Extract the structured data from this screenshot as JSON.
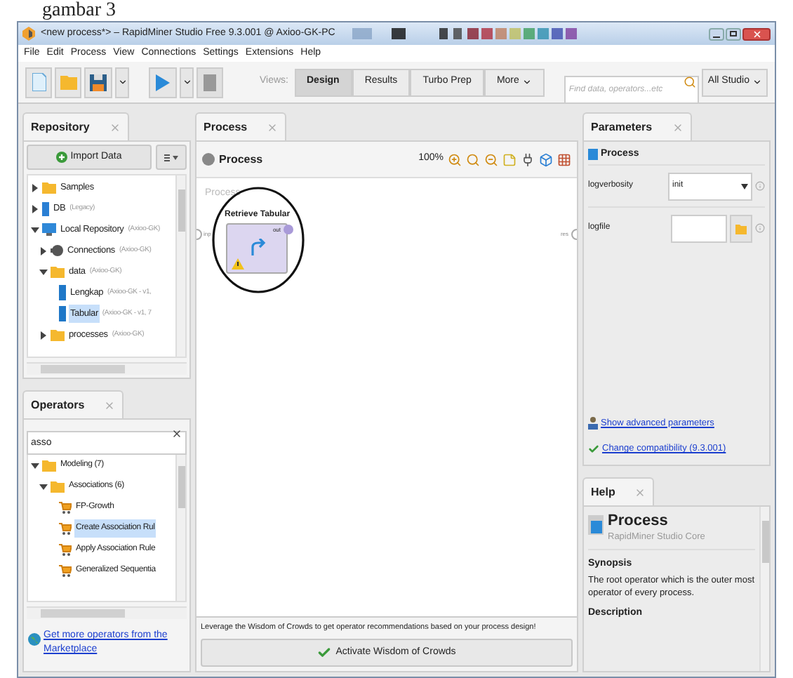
{
  "caption": "gambar 3",
  "window": {
    "title": "<new process*> – RapidMiner Studio Free 9.3.001 @ Axioo-GK-PC"
  },
  "menu": [
    "File",
    "Edit",
    "Process",
    "View",
    "Connections",
    "Settings",
    "Extensions",
    "Help"
  ],
  "toolbar": {
    "views_label": "Views:",
    "views": [
      {
        "label": "Design",
        "selected": true
      },
      {
        "label": "Results",
        "selected": false
      },
      {
        "label": "Turbo Prep",
        "selected": false
      },
      {
        "label": "More",
        "selected": false
      }
    ],
    "search": {
      "placeholder": "Find data, operators...etc"
    },
    "scope": "All Studio"
  },
  "repository": {
    "tab": "Repository",
    "import_button": "Import Data",
    "tree": [
      {
        "kind": "folder",
        "label": "Samples",
        "expanded": false,
        "selected": false
      },
      {
        "kind": "db",
        "label": "DB",
        "note": "(Legacy)",
        "expanded": false,
        "selected": false
      },
      {
        "kind": "repo",
        "label": "Local Repository",
        "note": "(Axioo-GK)",
        "expanded": true,
        "selected": false,
        "children": [
          {
            "kind": "connections",
            "label": "Connections",
            "note": "(Axioo-GK)",
            "expanded": false,
            "selected": false
          },
          {
            "kind": "folder",
            "label": "data",
            "note": "(Axioo-GK)",
            "expanded": true,
            "selected": false,
            "children": [
              {
                "kind": "data",
                "label": "Lengkap",
                "note": "(Axioo-GK - v1,",
                "selected": false
              },
              {
                "kind": "data",
                "label": "Tabular",
                "note": "(Axioo-GK - v1, 7",
                "selected": true
              }
            ]
          },
          {
            "kind": "folder",
            "label": "processes",
            "note": "(Axioo-GK)",
            "expanded": false,
            "selected": false
          }
        ]
      }
    ]
  },
  "operators": {
    "tab": "Operators",
    "search": "asso",
    "tree": [
      {
        "kind": "folder",
        "label": "Modeling (7)",
        "expanded": true,
        "selected": false,
        "children": [
          {
            "kind": "folder",
            "label": "Associations (6)",
            "expanded": true,
            "selected": false,
            "children": [
              {
                "kind": "operator",
                "label": "FP-Growth",
                "selected": false
              },
              {
                "kind": "operator",
                "label": "Create Association Rul",
                "selected": true
              },
              {
                "kind": "operator",
                "label": "Apply Association Rule",
                "selected": false
              },
              {
                "kind": "operator",
                "label": "Generalized Sequentia",
                "selected": false
              }
            ]
          }
        ]
      }
    ],
    "marketplace_link": "Get more operators from the Marketplace"
  },
  "process": {
    "tab": "Process",
    "breadcrumb": "Process",
    "zoom": "100%",
    "canvas_label": "Process",
    "input_port": "inp",
    "output_port": "res",
    "operator": {
      "name": "Retrieve Tabular",
      "port": "out",
      "warning": true
    },
    "hint": "Leverage the Wisdom of Crowds to get operator recommendations based on your process design!",
    "button": "Activate Wisdom of Crowds"
  },
  "parameters": {
    "tab": "Parameters",
    "operator": "Process",
    "fields": [
      {
        "kind": "select",
        "label": "logverbosity",
        "value": "init"
      },
      {
        "kind": "file",
        "label": "logfile"
      }
    ],
    "links": [
      {
        "kind": "advanced",
        "label": "Show advanced parameters"
      },
      {
        "kind": "compatibility",
        "label": "Change compatibility (9.3.001)"
      }
    ]
  },
  "help": {
    "tab": "Help",
    "title": "Process",
    "subtitle": "RapidMiner Studio Core",
    "sections": [
      {
        "heading": "Synopsis",
        "text": "The root operator which is the outer most operator of every process."
      },
      {
        "heading": "Description"
      }
    ]
  }
}
